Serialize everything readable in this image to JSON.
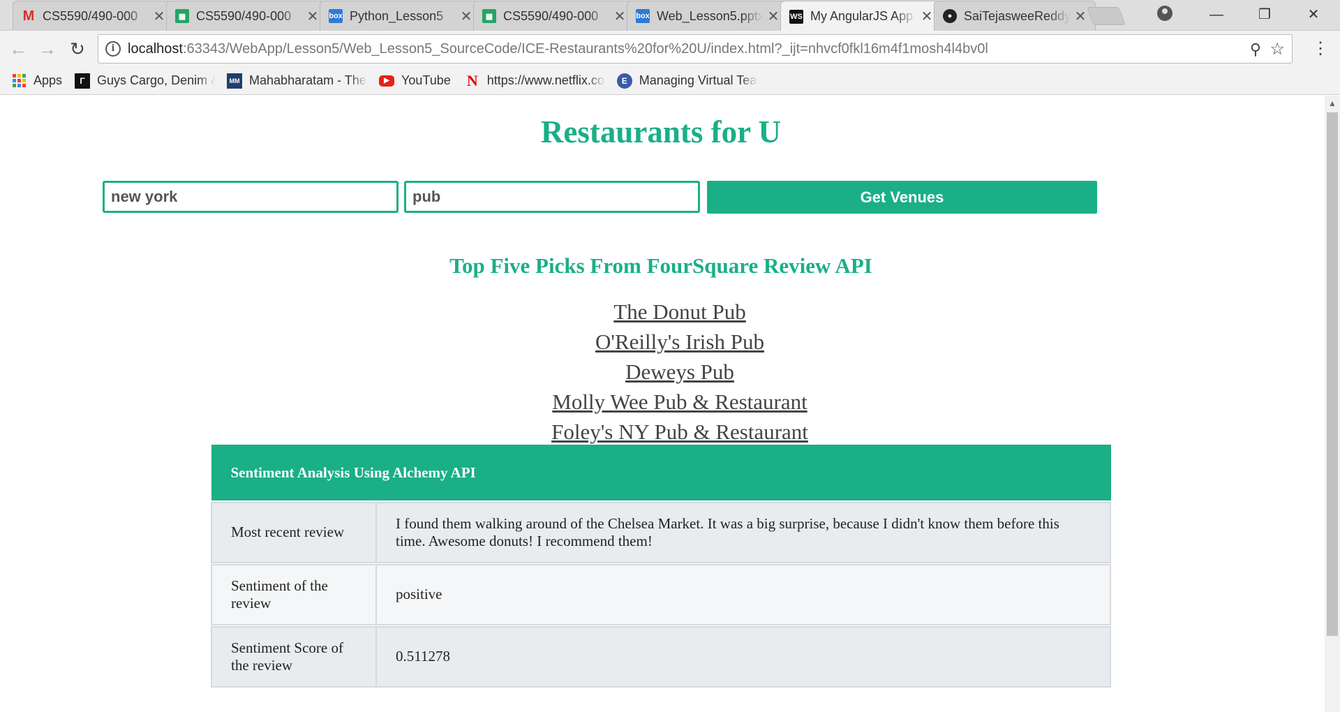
{
  "browser": {
    "tabs": [
      {
        "title": "CS5590/490-000",
        "favicon": "gmail-icon",
        "active": false
      },
      {
        "title": "CS5590/490-000",
        "favicon": "sheets-icon",
        "active": false
      },
      {
        "title": "Python_Lesson5",
        "favicon": "box-icon",
        "active": false
      },
      {
        "title": "CS5590/490-000",
        "favicon": "sheets-icon",
        "active": false
      },
      {
        "title": "Web_Lesson5.pptx",
        "favicon": "box-icon",
        "active": false
      },
      {
        "title": "My AngularJS App",
        "favicon": "webstorm-icon",
        "active": true
      },
      {
        "title": "SaiTejasweeReddy",
        "favicon": "github-icon",
        "active": false
      }
    ],
    "favicon_text": {
      "gmail": "M",
      "box": "box",
      "ws": "WS"
    },
    "url": {
      "host": "localhost",
      "path": ":63343/WebApp/Lesson5/Web_Lesson5_SourceCode/ICE-Restaurants%20for%20U/index.html?_ijt=nhvcf0fkl16m4f1mosh4l4bv0l"
    },
    "bookmarks": [
      {
        "label": "Apps"
      },
      {
        "label": "Guys Cargo, Denim &"
      },
      {
        "label": "Mahabharatam - The"
      },
      {
        "label": "YouTube"
      },
      {
        "label": "https://www.netflix.co"
      },
      {
        "label": "Managing Virtual Tea"
      }
    ],
    "bookmark_icon_text": {
      "netflix": "N",
      "managing": "E",
      "mhm": "MM"
    },
    "icons": {
      "back": "←",
      "forward": "→",
      "reload": "↻",
      "info": "i",
      "zoom": "⚲",
      "star": "☆",
      "menu": "⋮",
      "close": "✕",
      "minimize": "—",
      "restore": "❐",
      "window_close": "✕",
      "scroll_up": "▲"
    },
    "colors": {
      "gmail": "#d93025",
      "youtube": "#e62117",
      "netflix": "#e50914",
      "apps": [
        "#ea4335",
        "#fbbc05",
        "#34a853",
        "#4285f4",
        "#ea4335",
        "#fbbc05",
        "#34a853",
        "#4285f4",
        "#ea4335"
      ]
    }
  },
  "page": {
    "title": "Restaurants for U",
    "location_value": "new york",
    "query_value": "pub",
    "get_venues_label": "Get Venues",
    "picks_heading": "Top Five Picks From FourSquare Review API",
    "venues": [
      "The Donut Pub",
      "O'Reilly's Irish Pub",
      "Deweys Pub",
      "Molly Wee Pub & Restaurant",
      "Foley's NY Pub & Restaurant"
    ],
    "sentiment": {
      "header": "Sentiment Analysis Using Alchemy API",
      "rows": [
        {
          "label": "Most recent review",
          "value": "I found them walking around of the Chelsea Market. It was a big surprise, because I didn't know them before this time. Awesome donuts! I recommend them!"
        },
        {
          "label": "Sentiment of the review",
          "value": "positive"
        },
        {
          "label": "Sentiment Score of the review",
          "value": "0.511278"
        }
      ]
    },
    "accent_color": "#1aaf87"
  }
}
